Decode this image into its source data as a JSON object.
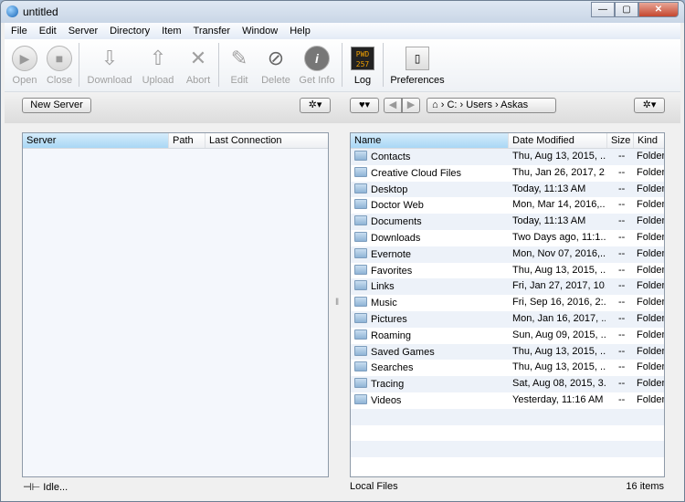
{
  "window": {
    "title": "untitled"
  },
  "menu": [
    "File",
    "Edit",
    "Server",
    "Directory",
    "Item",
    "Transfer",
    "Window",
    "Help"
  ],
  "toolbar": {
    "open": "Open",
    "close": "Close",
    "download": "Download",
    "upload": "Upload",
    "abort": "Abort",
    "edit": "Edit",
    "delete": "Delete",
    "get_info": "Get Info",
    "log": "Log",
    "log_icon_text": "PWD 257",
    "preferences": "Preferences"
  },
  "left": {
    "new_server": "New Server",
    "columns": [
      "Server",
      "Path",
      "Last Connection"
    ],
    "status": "Idle..."
  },
  "right": {
    "breadcrumb": [
      "C:",
      "Users",
      "Askas"
    ],
    "columns": [
      "Name",
      "Date Modified",
      "Size",
      "Kind"
    ],
    "rows": [
      [
        "Contacts",
        "Thu, Aug 13, 2015, ...",
        "--",
        "Folder"
      ],
      [
        "Creative Cloud Files",
        "Thu, Jan 26, 2017, 2...",
        "--",
        "Folder"
      ],
      [
        "Desktop",
        "Today, 11:13 AM",
        "--",
        "Folder"
      ],
      [
        "Doctor Web",
        "Mon, Mar 14, 2016,...",
        "--",
        "Folder"
      ],
      [
        "Documents",
        "Today, 11:13 AM",
        "--",
        "Folder"
      ],
      [
        "Downloads",
        "Two Days ago, 11:1...",
        "--",
        "Folder"
      ],
      [
        "Evernote",
        "Mon, Nov 07, 2016,...",
        "--",
        "Folder"
      ],
      [
        "Favorites",
        "Thu, Aug 13, 2015, ...",
        "--",
        "Folder"
      ],
      [
        "Links",
        "Fri, Jan 27, 2017, 10...",
        "--",
        "Folder"
      ],
      [
        "Music",
        "Fri, Sep 16, 2016, 2:...",
        "--",
        "Folder"
      ],
      [
        "Pictures",
        "Mon, Jan 16, 2017, ...",
        "--",
        "Folder"
      ],
      [
        "Roaming",
        "Sun, Aug 09, 2015, ...",
        "--",
        "Folder"
      ],
      [
        "Saved Games",
        "Thu, Aug 13, 2015, ...",
        "--",
        "Folder"
      ],
      [
        "Searches",
        "Thu, Aug 13, 2015, ...",
        "--",
        "Folder"
      ],
      [
        "Tracing",
        "Sat, Aug 08, 2015, 3...",
        "--",
        "Folder"
      ],
      [
        "Videos",
        "Yesterday, 11:16 AM",
        "--",
        "Folder"
      ]
    ],
    "status_left": "Local Files",
    "status_right": "16 items"
  }
}
